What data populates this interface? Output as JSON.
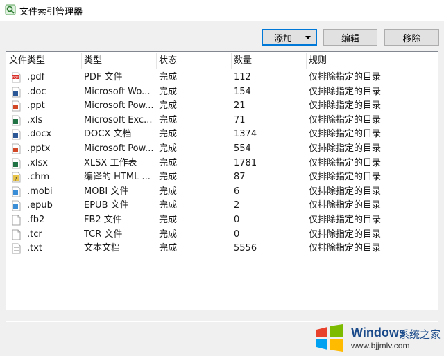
{
  "window": {
    "title": "文件索引管理器"
  },
  "toolbar": {
    "add_label": "添加",
    "edit_label": "编辑",
    "remove_label": "移除"
  },
  "table": {
    "columns": [
      "文件类型",
      "类型",
      "状态",
      "数量",
      "规则"
    ],
    "rows": [
      {
        "ext": ".pdf",
        "kind": "PDF 文件",
        "status": "完成",
        "count": "112",
        "rule": "仅排除指定的目录",
        "icon": "pdf-file-icon"
      },
      {
        "ext": ".doc",
        "kind": "Microsoft Wo...",
        "status": "完成",
        "count": "154",
        "rule": "仅排除指定的目录",
        "icon": "word-file-icon"
      },
      {
        "ext": ".ppt",
        "kind": "Microsoft Pow...",
        "status": "完成",
        "count": "21",
        "rule": "仅排除指定的目录",
        "icon": "powerpoint-file-icon"
      },
      {
        "ext": ".xls",
        "kind": "Microsoft Exc...",
        "status": "完成",
        "count": "71",
        "rule": "仅排除指定的目录",
        "icon": "excel-file-icon"
      },
      {
        "ext": ".docx",
        "kind": "DOCX 文档",
        "status": "完成",
        "count": "1374",
        "rule": "仅排除指定的目录",
        "icon": "docx-file-icon"
      },
      {
        "ext": ".pptx",
        "kind": "Microsoft Pow...",
        "status": "完成",
        "count": "554",
        "rule": "仅排除指定的目录",
        "icon": "pptx-file-icon"
      },
      {
        "ext": ".xlsx",
        "kind": "XLSX 工作表",
        "status": "完成",
        "count": "1781",
        "rule": "仅排除指定的目录",
        "icon": "xlsx-file-icon"
      },
      {
        "ext": ".chm",
        "kind": "编译的 HTML ...",
        "status": "完成",
        "count": "87",
        "rule": "仅排除指定的目录",
        "icon": "chm-file-icon"
      },
      {
        "ext": ".mobi",
        "kind": "MOBI 文件",
        "status": "完成",
        "count": "6",
        "rule": "仅排除指定的目录",
        "icon": "mobi-file-icon"
      },
      {
        "ext": ".epub",
        "kind": "EPUB 文件",
        "status": "完成",
        "count": "2",
        "rule": "仅排除指定的目录",
        "icon": "epub-file-icon"
      },
      {
        "ext": ".fb2",
        "kind": "FB2 文件",
        "status": "完成",
        "count": "0",
        "rule": "仅排除指定的目录",
        "icon": "blank-file-icon"
      },
      {
        "ext": ".tcr",
        "kind": "TCR 文件",
        "status": "完成",
        "count": "0",
        "rule": "仅排除指定的目录",
        "icon": "blank-file-icon"
      },
      {
        "ext": ".txt",
        "kind": "文本文档",
        "status": "完成",
        "count": "5556",
        "rule": "仅排除指定的目录",
        "icon": "text-file-icon"
      }
    ]
  },
  "watermark": {
    "brand": "Windows",
    "suffix": "系统之家",
    "url": "www.bjjmlv.com"
  },
  "colors": {
    "accent": "#0078d7",
    "pdf": "#d9302a",
    "word": "#2b5797",
    "powerpoint": "#d24726",
    "excel": "#217346",
    "mobi": "#3a8ed8"
  }
}
